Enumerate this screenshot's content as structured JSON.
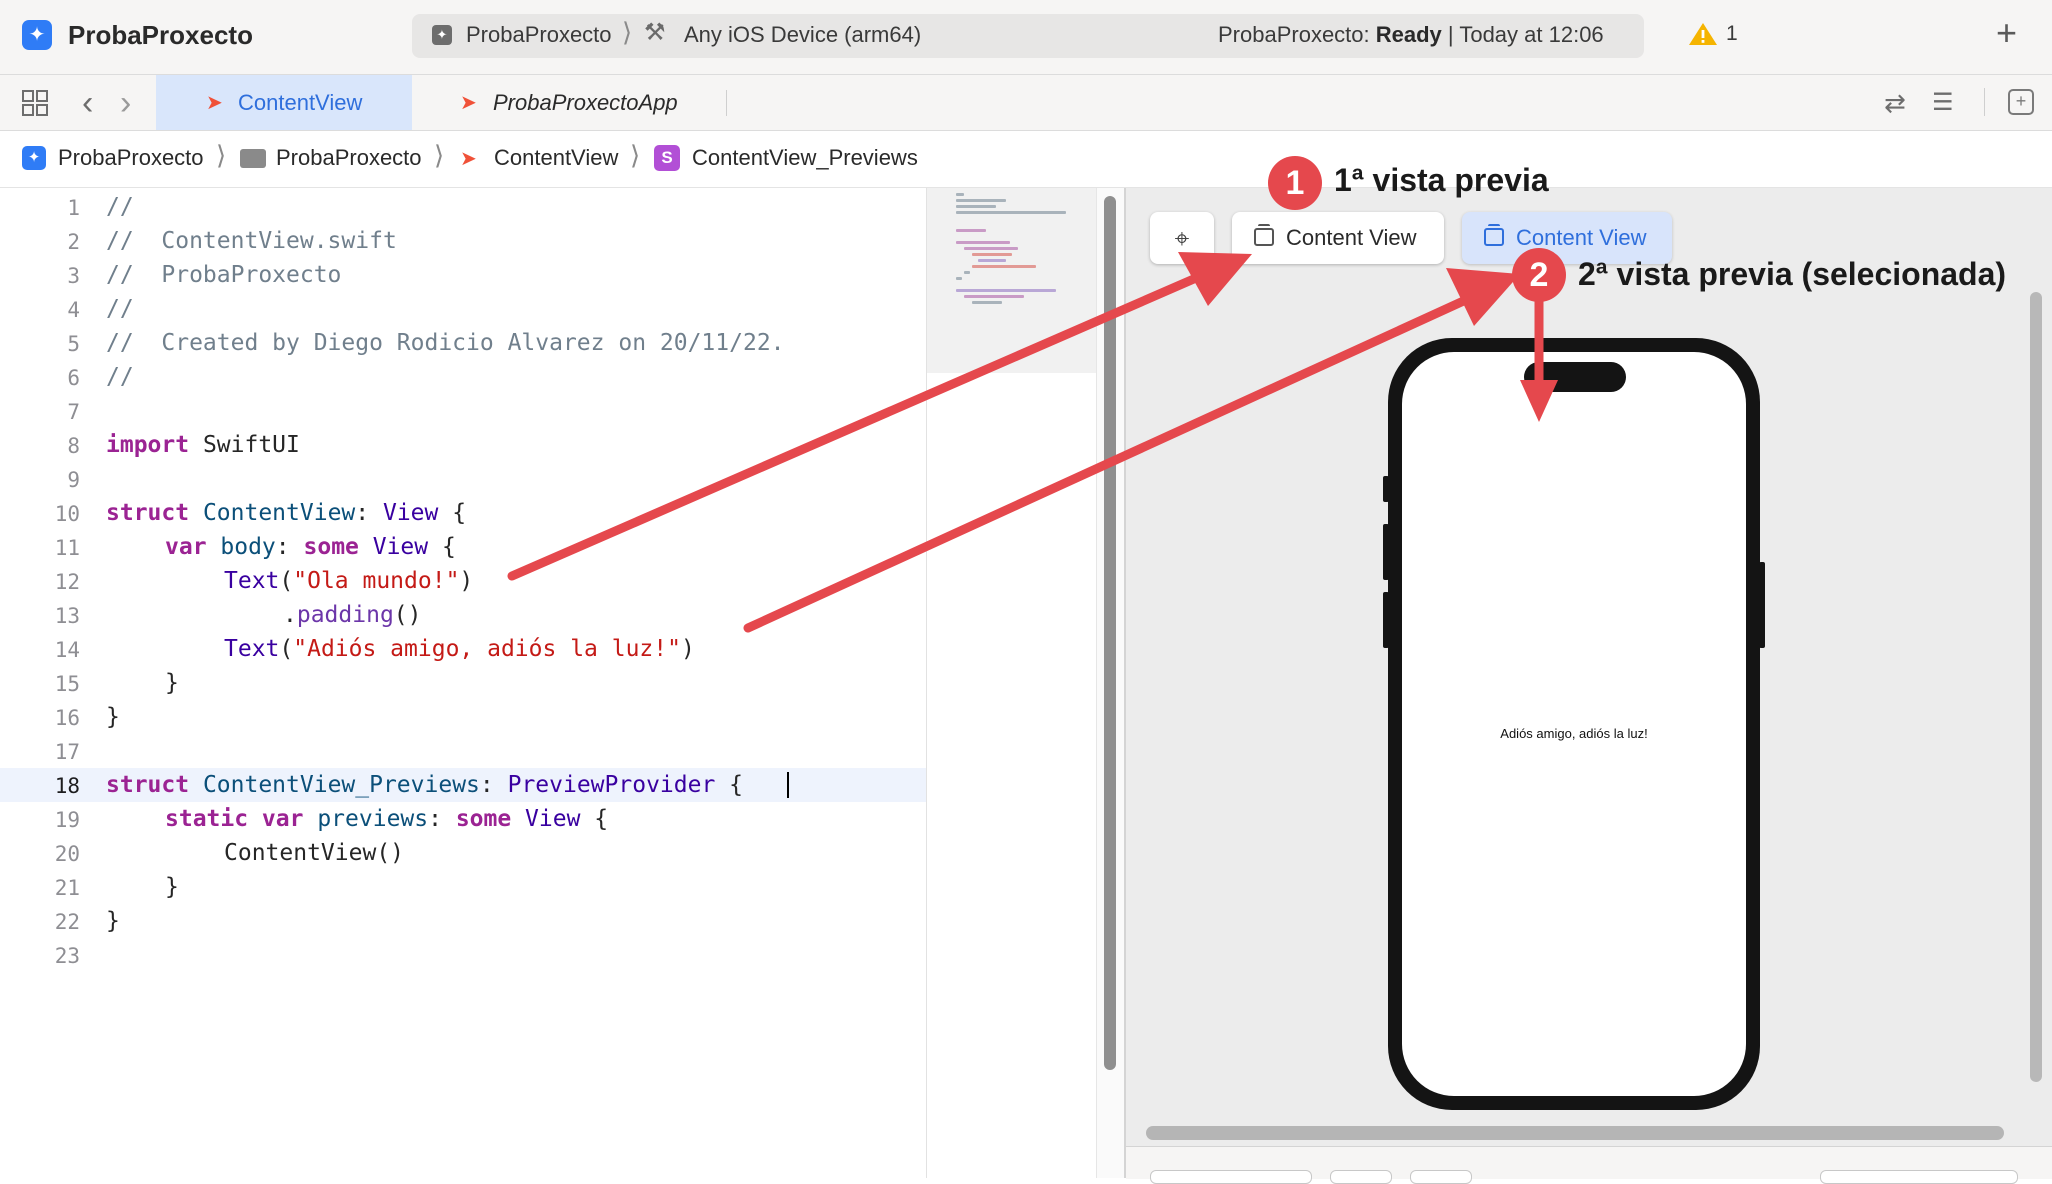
{
  "toolbar": {
    "app_title": "ProbaProxecto",
    "scheme_name": "ProbaProxecto",
    "device_name": "Any iOS Device (arm64)",
    "status_prefix": "ProbaProxecto: ",
    "status_state": "Ready",
    "status_suffix": " | Today at 12:06",
    "warning_count": "1",
    "icons": [
      "app-icon",
      "hammer-icon",
      "warning-icon",
      "plus-icon"
    ]
  },
  "tabs": [
    {
      "label": "ContentView",
      "active": true
    },
    {
      "label": "ProbaProxectoApp",
      "active": false
    }
  ],
  "breadcrumb": [
    "ProbaProxecto",
    "ProbaProxecto",
    "ContentView",
    "ContentView_Previews"
  ],
  "editor": {
    "current_line": 18,
    "line_numbers": [
      "1",
      "2",
      "3",
      "4",
      "5",
      "6",
      "7",
      "8",
      "9",
      "10",
      "11",
      "12",
      "13",
      "14",
      "15",
      "16",
      "17",
      "18",
      "19",
      "20",
      "21",
      "22",
      "23"
    ],
    "lines": {
      "l1": "//",
      "l2": "//  ContentView.swift",
      "l3": "//  ProbaProxecto",
      "l4": "//",
      "l5": "//  Created by Diego Rodicio Alvarez on 20/11/22.",
      "l6": "//",
      "l8_kw": "import",
      "l8_rest": " SwiftUI",
      "l10_kw": "struct",
      "l10_name": " ContentView",
      "l10_colon": ": ",
      "l10_type": "View",
      "l10_end": " {",
      "l11_kw": "var",
      "l11_name": " body",
      "l11_colon": ": ",
      "l11_some": "some",
      "l11_type": " View",
      "l11_end": " {",
      "l12_fn": "Text",
      "l12_open": "(",
      "l12_str": "\"Ola mundo!\"",
      "l12_close": ")",
      "l13_dot": ".",
      "l13_fn": "padding",
      "l13_end": "()",
      "l14_fn": "Text",
      "l14_open": "(",
      "l14_str": "\"Adiós amigo, adiós la luz!\"",
      "l14_close": ")",
      "l15": "}",
      "l16": "}",
      "l18_kw": "struct",
      "l18_name": " ContentView_Previews",
      "l18_colon": ": ",
      "l18_type": "PreviewProvider",
      "l18_end": " {",
      "l19_kw": "static var",
      "l19_name": " previews",
      "l19_colon": ": ",
      "l19_some": "some",
      "l19_type": " View",
      "l19_end": " {",
      "l20": "ContentView()",
      "l21": "}",
      "l22": "}"
    }
  },
  "preview": {
    "pin_icon": "pin-icon",
    "buttons": [
      {
        "label": "Content View",
        "selected": false
      },
      {
        "label": "Content View",
        "selected": true
      }
    ],
    "phone_text": "Adiós amigo, adiós la luz!"
  },
  "annotations": [
    {
      "number": "1",
      "label": "1ª vista previa"
    },
    {
      "number": "2",
      "label": "2ª vista previa (selecionada)"
    }
  ],
  "colors": {
    "accent": "#2f6fdc",
    "annotation": "#e5484d",
    "keyword": "#9b2393",
    "string": "#c41a16",
    "comment": "#707f8c"
  }
}
